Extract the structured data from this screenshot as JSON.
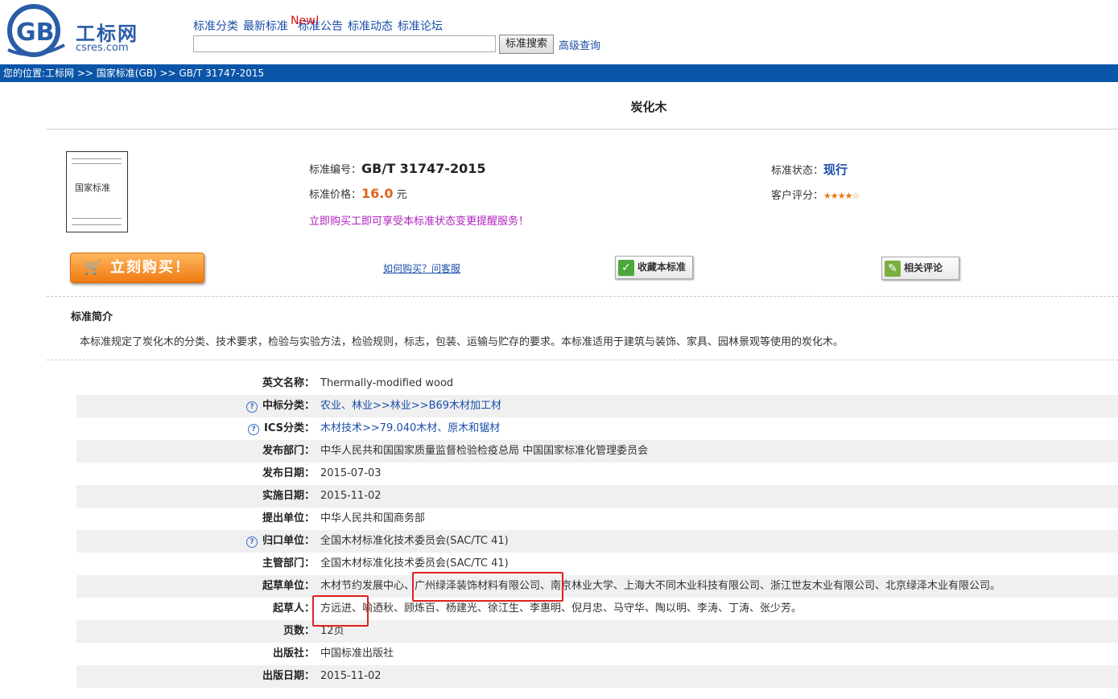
{
  "logo": {
    "letters": "GB",
    "name": "工标网",
    "domain": "csres.com"
  },
  "topnav": {
    "items": [
      "标准分类",
      "最新标准",
      "标准公告",
      "标准动态",
      "标准论坛"
    ],
    "new_badge": "New!",
    "search_button": "标准搜索",
    "advanced": "高级查询"
  },
  "breadcrumb": "您的位置:工标网 >> 国家标准(GB) >> GB/T 31747-2015",
  "title": "炭化木",
  "cover": {
    "text": "国家标准"
  },
  "summary": {
    "num_label": "标准编号：",
    "num_value": "GB/T 31747-2015",
    "price_label": "标准价格：",
    "price_value": "16.0",
    "price_unit": " 元",
    "promo": "立即购买工即可享受本标准状态变更提醒服务！",
    "status_label": "标准状态：",
    "status_value": "现行",
    "rating_label": "客户评分：",
    "rating_stars": "★★★★☆"
  },
  "actions": {
    "buy": "立刻购买！",
    "howbuy": "如何购买？问客服",
    "favorite": "收藏本标准",
    "review": "相关评论"
  },
  "intro": {
    "heading": "标准简介",
    "text": "本标准规定了炭化木的分类、技术要求，检验与实验方法，检验规则，标志，包装、运输与贮存的要求。本标准适用于建筑与装饰、家具、园林景观等使用的炭化木。"
  },
  "details": [
    {
      "label": "英文名称：",
      "value": "Thermally-modified wood",
      "help": false
    },
    {
      "label": "中标分类：",
      "value": "农业、林业>>林业>>B69木材加工材",
      "help": true,
      "link": true
    },
    {
      "label": "ICS分类：",
      "value": "木材技术>>79.040木材、原木和锯材",
      "help": true,
      "link": true
    },
    {
      "label": "发布部门：",
      "value": "中华人民共和国国家质量监督检验检疫总局 中国国家标准化管理委员会",
      "help": false
    },
    {
      "label": "发布日期：",
      "value": "2015-07-03",
      "help": false
    },
    {
      "label": "实施日期：",
      "value": "2015-11-02",
      "help": false
    },
    {
      "label": "提出单位：",
      "value": "中华人民共和国商务部",
      "help": false
    },
    {
      "label": "归口单位：",
      "value": "全国木材标准化技术委员会(SAC/TC 41)",
      "help": true
    },
    {
      "label": "主管部门：",
      "value": "全国木材标准化技术委员会(SAC/TC 41)",
      "help": false
    },
    {
      "label": "起草单位：",
      "value": "木材节约发展中心、广州绿泽装饰材料有限公司、南京林业大学、上海大不同木业科技有限公司、浙江世友木业有限公司、北京绿泽木业有限公司。",
      "help": false
    },
    {
      "label": "起草人：",
      "value": "方远进、喻迺秋、顾炼百、杨建光、徐江生、李惠明、倪月忠、马守华、陶以明、李涛、丁涛、张少芳。",
      "help": false
    },
    {
      "label": "页数：",
      "value": "12页",
      "help": false
    },
    {
      "label": "出版社：",
      "value": "中国标准出版社",
      "help": false
    },
    {
      "label": "出版日期：",
      "value": "2015-11-02",
      "help": false
    }
  ]
}
